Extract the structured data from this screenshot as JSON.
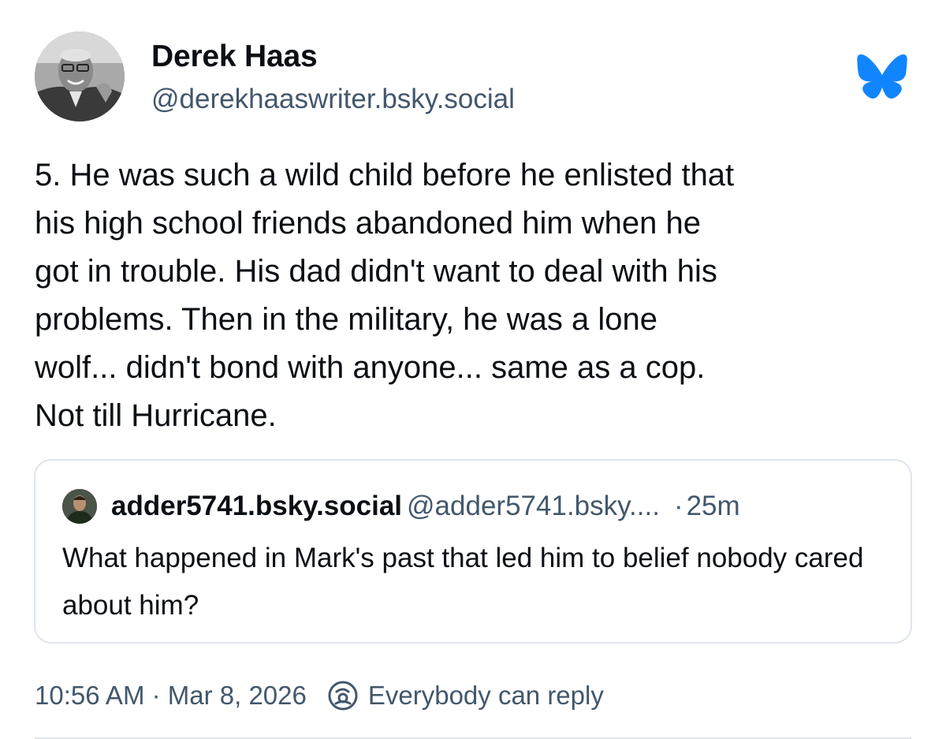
{
  "author": {
    "display_name": "Derek Haas",
    "handle": "@derekhaaswriter.bsky.social"
  },
  "post": {
    "text": "5.  He was such a wild child before he enlisted that\nhis high school friends abandoned him when he\ngot in trouble.  His dad didn't want to deal with his\nproblems.  Then in the military, he was a lone\nwolf... didn't bond with anyone... same as a cop.\nNot till Hurricane."
  },
  "quote": {
    "display_name": "adder5741.bsky.social",
    "handle": "@adder5741.bsky....",
    "separator": "·",
    "time": "25m",
    "text": "What happened in Mark's past that led him to belief nobody cared about him?"
  },
  "footer": {
    "timestamp": "10:56 AM · Mar 8, 2026",
    "reply_setting": "Everybody can reply"
  },
  "colors": {
    "brand_blue": "#1185fe",
    "muted_text": "#42576c",
    "border": "#dfe5ec"
  },
  "icons": {
    "logo": "bluesky-butterfly-icon",
    "reply_setting": "everybody-reply-icon"
  }
}
